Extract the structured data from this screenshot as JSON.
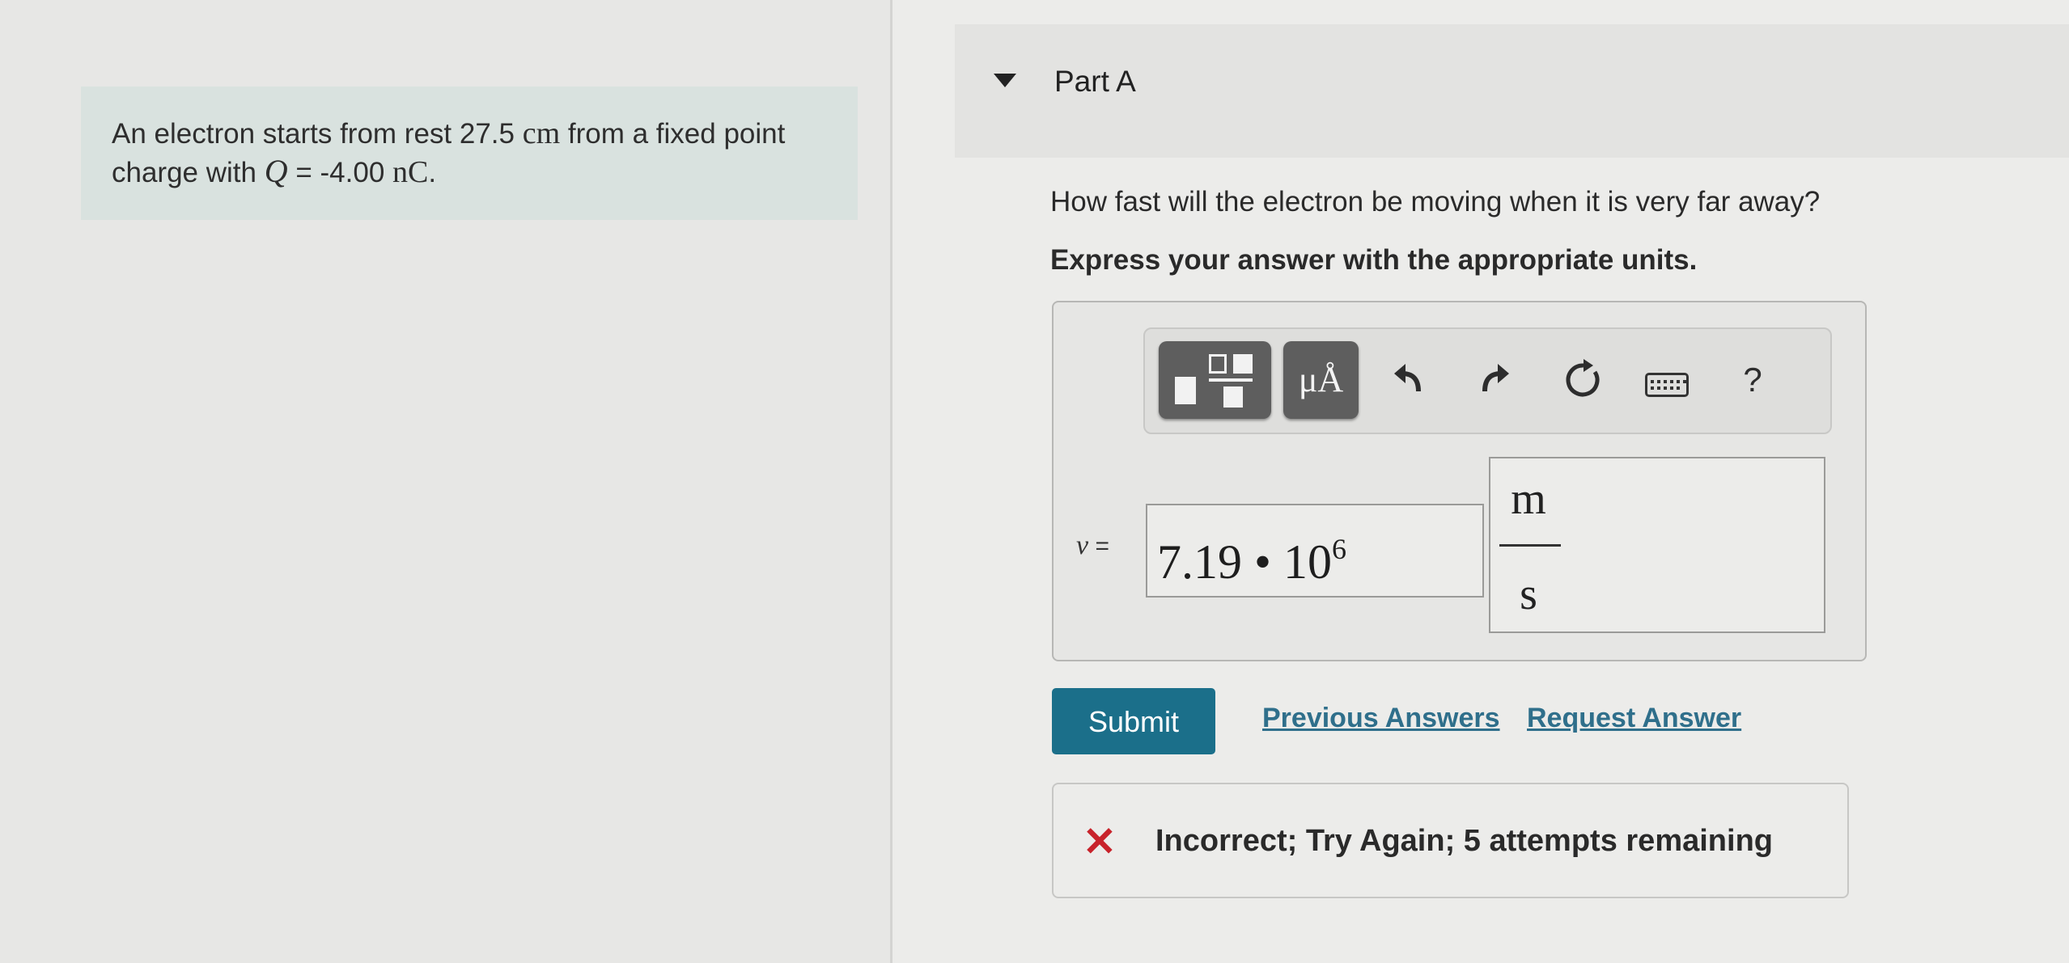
{
  "problem": {
    "text_before_distance": "An electron starts from rest 27.5",
    "distance_unit": "cm",
    "text_after_distance": "from a fixed point charge with",
    "charge_symbol": "Q",
    "charge_value": "= -4.00",
    "charge_unit": "nC",
    "end": "."
  },
  "part": {
    "title": "Part A",
    "question": "How fast will the electron be moving when it is very far away?",
    "instruction": "Express your answer with the appropriate units."
  },
  "toolbar": {
    "units_label": "μÅ",
    "icons": [
      "templates-icon",
      "units-icon",
      "undo-icon",
      "redo-icon",
      "reset-icon",
      "keyboard-icon",
      "help-icon"
    ],
    "help_label": "?"
  },
  "answer": {
    "variable": "v",
    "equals": "=",
    "mantissa": "7.19",
    "times": "•",
    "base": "10",
    "exponent": "6",
    "unit_numerator": "m",
    "unit_denominator": "s"
  },
  "actions": {
    "submit_label": "Submit",
    "previous_answers_label": "Previous Answers",
    "request_answer_label": "Request Answer"
  },
  "feedback": {
    "icon": "x-icon",
    "text": "Incorrect; Try Again; 5 attempts remaining",
    "color": "#c8232b"
  },
  "colors": {
    "submit": "#1b6f8a",
    "link": "#2f6f8b",
    "problem_background": "#d9e2df"
  }
}
